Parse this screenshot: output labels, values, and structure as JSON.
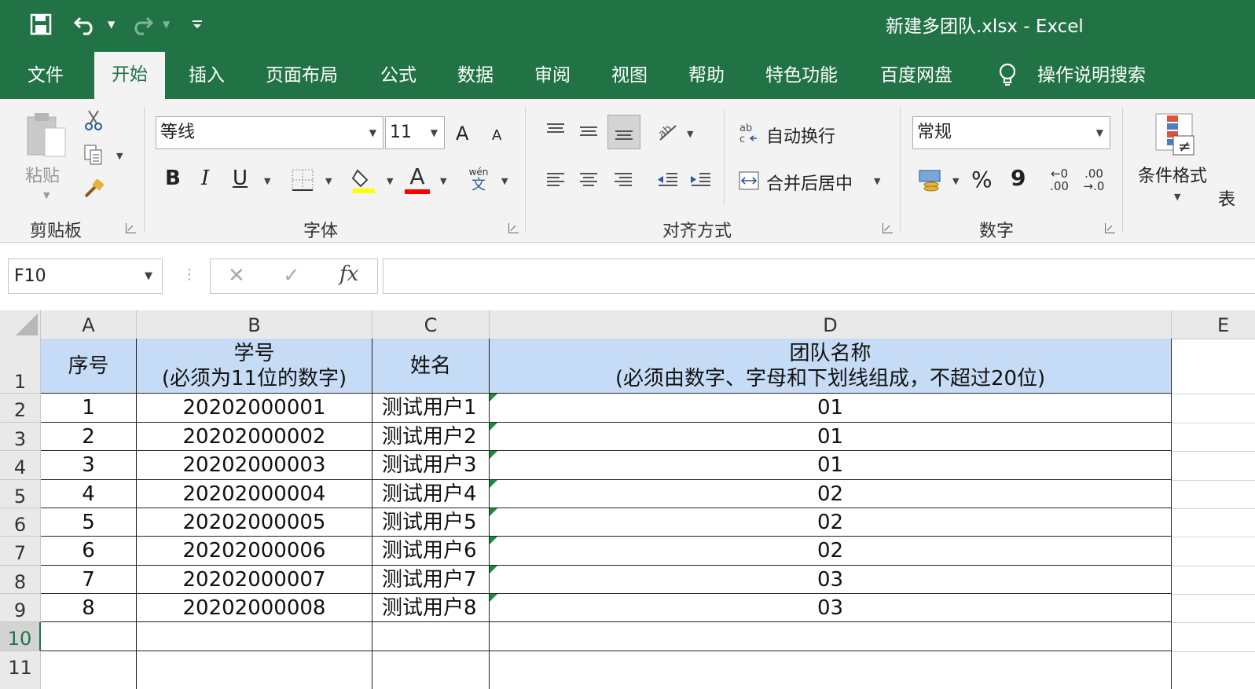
{
  "window": {
    "doc_title": "新建多团队.xlsx  -  Excel"
  },
  "quick_access": {
    "save_icon": "save-icon",
    "undo_icon": "undo-icon",
    "redo_icon": "redo-icon",
    "customize_icon": "customize-qat-icon"
  },
  "tabs": [
    "文件",
    "开始",
    "插入",
    "页面布局",
    "公式",
    "数据",
    "审阅",
    "视图",
    "帮助",
    "特色功能",
    "百度网盘",
    "操作说明搜索"
  ],
  "active_tab": "开始",
  "ribbon": {
    "clipboard": {
      "paste_label": "粘贴",
      "group_label": "剪贴板"
    },
    "font": {
      "font_name": "等线",
      "font_size": "11",
      "bold": "B",
      "italic": "I",
      "underline": "U",
      "grow": "A",
      "shrink": "A",
      "phonetic": "wén",
      "phonetic_char": "文",
      "group_label": "字体",
      "highlight_color": "#ffff00",
      "font_color": "#ff0000"
    },
    "alignment": {
      "wrap_text": "自动换行",
      "merge_center": "合并后居中",
      "group_label": "对齐方式"
    },
    "number": {
      "format": "常规",
      "percent": "%",
      "comma": "9",
      "inc_decimal_top": "←0",
      "inc_decimal_bottom": ".00",
      "dec_decimal_top": ".00",
      "dec_decimal_bottom": "→.0",
      "group_label": "数字"
    },
    "styles": {
      "conditional_format": "条件格式",
      "table_format_partial": "表"
    }
  },
  "formula_bar": {
    "name_box": "F10",
    "cancel": "✕",
    "enter": "✓",
    "fx": "fx",
    "value": ""
  },
  "sheet": {
    "columns": [
      "A",
      "B",
      "C",
      "D",
      "E"
    ],
    "row_numbers": [
      "1",
      "2",
      "3",
      "4",
      "5",
      "6",
      "7",
      "8",
      "9",
      "10",
      "11"
    ],
    "selected_row": "10",
    "header": {
      "a": "序号",
      "b1": "学号",
      "b2": "(必须为11位的数字)",
      "c": "姓名",
      "d1": "团队名称",
      "d2": "(必须由数字、字母和下划线组成，不超过20位)"
    },
    "rows": [
      {
        "seq": "1",
        "id": "20202000001",
        "name": "测试用户1",
        "team": "01"
      },
      {
        "seq": "2",
        "id": "20202000002",
        "name": "测试用户2",
        "team": "01"
      },
      {
        "seq": "3",
        "id": "20202000003",
        "name": "测试用户3",
        "team": "01"
      },
      {
        "seq": "4",
        "id": "20202000004",
        "name": "测试用户4",
        "team": "02"
      },
      {
        "seq": "5",
        "id": "20202000005",
        "name": "测试用户5",
        "team": "02"
      },
      {
        "seq": "6",
        "id": "20202000006",
        "name": "测试用户6",
        "team": "02"
      },
      {
        "seq": "7",
        "id": "20202000007",
        "name": "测试用户7",
        "team": "03"
      },
      {
        "seq": "8",
        "id": "20202000008",
        "name": "测试用户8",
        "team": "03"
      }
    ],
    "header_fill": "#c6dcf6",
    "accent": "#217346"
  }
}
